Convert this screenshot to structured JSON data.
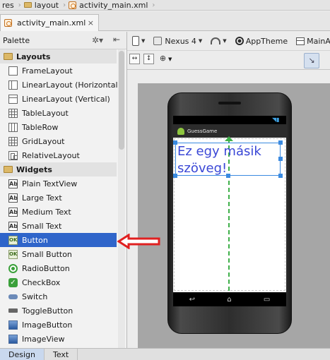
{
  "breadcrumb": {
    "items": [
      {
        "label": "res",
        "icon": "folder-icon"
      },
      {
        "label": "layout",
        "icon": "folder-icon"
      },
      {
        "label": "activity_main.xml",
        "icon": "xml-file-icon"
      }
    ]
  },
  "editor_tab": {
    "label": "activity_main.xml",
    "close": "×"
  },
  "palette": {
    "title": "Palette",
    "categories": [
      {
        "label": "Layouts",
        "items": [
          {
            "label": "FrameLayout",
            "icon": "frame-layout-icon"
          },
          {
            "label": "LinearLayout (Horizontal)",
            "icon": "linear-horizontal-icon"
          },
          {
            "label": "LinearLayout (Vertical)",
            "icon": "linear-vertical-icon"
          },
          {
            "label": "TableLayout",
            "icon": "table-layout-icon"
          },
          {
            "label": "TableRow",
            "icon": "table-row-icon"
          },
          {
            "label": "GridLayout",
            "icon": "grid-layout-icon"
          },
          {
            "label": "RelativeLayout",
            "icon": "relative-layout-icon"
          }
        ]
      },
      {
        "label": "Widgets",
        "items": [
          {
            "label": "Plain TextView",
            "icon": "textview-icon"
          },
          {
            "label": "Large Text",
            "icon": "textview-icon"
          },
          {
            "label": "Medium Text",
            "icon": "textview-icon"
          },
          {
            "label": "Small Text",
            "icon": "textview-icon"
          },
          {
            "label": "Button",
            "icon": "button-icon",
            "selected": true
          },
          {
            "label": "Small Button",
            "icon": "button-icon"
          },
          {
            "label": "RadioButton",
            "icon": "radio-button-icon"
          },
          {
            "label": "CheckBox",
            "icon": "checkbox-icon"
          },
          {
            "label": "Switch",
            "icon": "switch-icon"
          },
          {
            "label": "ToggleButton",
            "icon": "toggle-button-icon"
          },
          {
            "label": "ImageButton",
            "icon": "image-button-icon"
          },
          {
            "label": "ImageView",
            "icon": "image-view-icon"
          }
        ]
      }
    ]
  },
  "toolbar": {
    "device": "Nexus 4",
    "theme": "AppTheme",
    "activity": "MainA"
  },
  "preview": {
    "app_title": "GuessGame",
    "textview_text": "Ez egy másik szöveg!"
  },
  "bottom_tabs": [
    {
      "label": "Design",
      "active": true
    },
    {
      "label": "Text",
      "active": false
    }
  ],
  "colors": {
    "selection": "#2f65ca",
    "textview": "#3a47d6",
    "guide": "#3fb04a",
    "annotation_arrow": "#e02020"
  }
}
